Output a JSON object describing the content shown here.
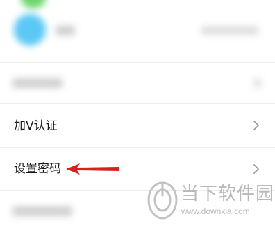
{
  "settings": {
    "items": [
      {
        "label": "加V认证",
        "chevron_icon": "chevron-right-icon"
      },
      {
        "label": "设置密码",
        "chevron_icon": "chevron-right-icon"
      }
    ]
  },
  "annotation": {
    "arrow_icon": "arrow-left-icon",
    "arrow_color": "#d9201f"
  },
  "watermark": {
    "title": "当下软件园",
    "url": "www.downxia.com"
  },
  "colors": {
    "page_bg": "#f2f2f2",
    "row_bg": "#ffffff",
    "avatar_blue": "#5cc8f5",
    "top_green": "#6cd46c"
  }
}
